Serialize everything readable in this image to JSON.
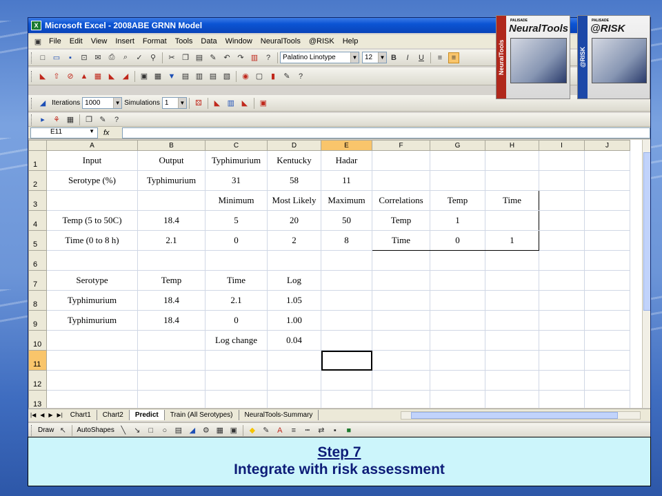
{
  "app": {
    "title": "Microsoft Excel - 2008ABE GRNN Model",
    "icon": "X"
  },
  "menu": [
    "File",
    "Edit",
    "View",
    "Insert",
    "Format",
    "Tools",
    "Data",
    "Window",
    "NeuralTools",
    "@RISK",
    "Help"
  ],
  "format_toolbar": {
    "font": "Palatino Linotype",
    "size": "12",
    "bold": "B",
    "italic": "I",
    "underline": "U"
  },
  "risk_toolbar": {
    "iterations_label": "Iterations",
    "iterations_value": "1000",
    "simulations_label": "Simulations",
    "simulations_value": "1"
  },
  "name_box": "E11",
  "fx": "fx",
  "columns": [
    "A",
    "B",
    "C",
    "D",
    "E",
    "F",
    "G",
    "H",
    "I",
    "J"
  ],
  "rows": [
    {
      "n": "1",
      "cells": [
        "Input",
        "Output",
        "Typhimurium",
        "Kentucky",
        "Hadar",
        "",
        "",
        "",
        "",
        ""
      ]
    },
    {
      "n": "2",
      "cells": [
        "Serotype (%)",
        "Typhimurium",
        "31",
        "58",
        "11",
        "",
        "",
        "",
        "",
        ""
      ]
    },
    {
      "n": "3",
      "cells": [
        "",
        "",
        "Minimum",
        "Most Likely",
        "Maximum",
        "Correlations",
        "Temp",
        "Time",
        "",
        ""
      ]
    },
    {
      "n": "4",
      "cells": [
        "Temp (5 to 50C)",
        "18.4",
        "5",
        "20",
        "50",
        "Temp",
        "1",
        "",
        "",
        ""
      ]
    },
    {
      "n": "5",
      "cells": [
        "Time (0 to 8 h)",
        "2.1",
        "0",
        "2",
        "8",
        "Time",
        "0",
        "1",
        "",
        ""
      ]
    },
    {
      "n": "6",
      "cells": [
        "",
        "",
        "",
        "",
        "",
        "",
        "",
        "",
        "",
        ""
      ]
    },
    {
      "n": "7",
      "cells": [
        "Serotype",
        "Temp",
        "Time",
        "Log",
        "",
        "",
        "",
        "",
        "",
        ""
      ]
    },
    {
      "n": "8",
      "cells": [
        "Typhimurium",
        "18.4",
        "2.1",
        "1.05",
        "",
        "",
        "",
        "",
        "",
        ""
      ]
    },
    {
      "n": "9",
      "cells": [
        "Typhimurium",
        "18.4",
        "0",
        "1.00",
        "",
        "",
        "",
        "",
        "",
        ""
      ]
    },
    {
      "n": "10",
      "cells": [
        "",
        "",
        "Log change",
        "0.04",
        "",
        "",
        "",
        "",
        "",
        ""
      ]
    },
    {
      "n": "11",
      "cells": [
        "",
        "",
        "",
        "",
        "",
        "",
        "",
        "",
        "",
        ""
      ]
    },
    {
      "n": "12",
      "cells": [
        "",
        "",
        "",
        "",
        "",
        "",
        "",
        "",
        "",
        ""
      ]
    },
    {
      "n": "13",
      "cells": [
        "",
        "",
        "",
        "",
        "",
        "",
        "",
        "",
        "",
        ""
      ]
    }
  ],
  "sheet_tabs": [
    "Chart1",
    "Chart2",
    "Predict",
    "Train (All Serotypes)",
    "NeuralTools-Summary"
  ],
  "active_tab": "Predict",
  "draw_toolbar": {
    "draw": "Draw",
    "autoshapes": "AutoShapes"
  },
  "products": [
    {
      "brand": "PALISADE",
      "name": "NeuralTools",
      "band_text": "NeuralTools",
      "band_color": "#b0281c"
    },
    {
      "brand": "PALISADE",
      "name": "@RISK",
      "band_text": "@RISK",
      "band_color": "#1c48a8"
    }
  ],
  "banner": {
    "line1": "Step 7",
    "line2": "Integrate with risk assessment"
  }
}
